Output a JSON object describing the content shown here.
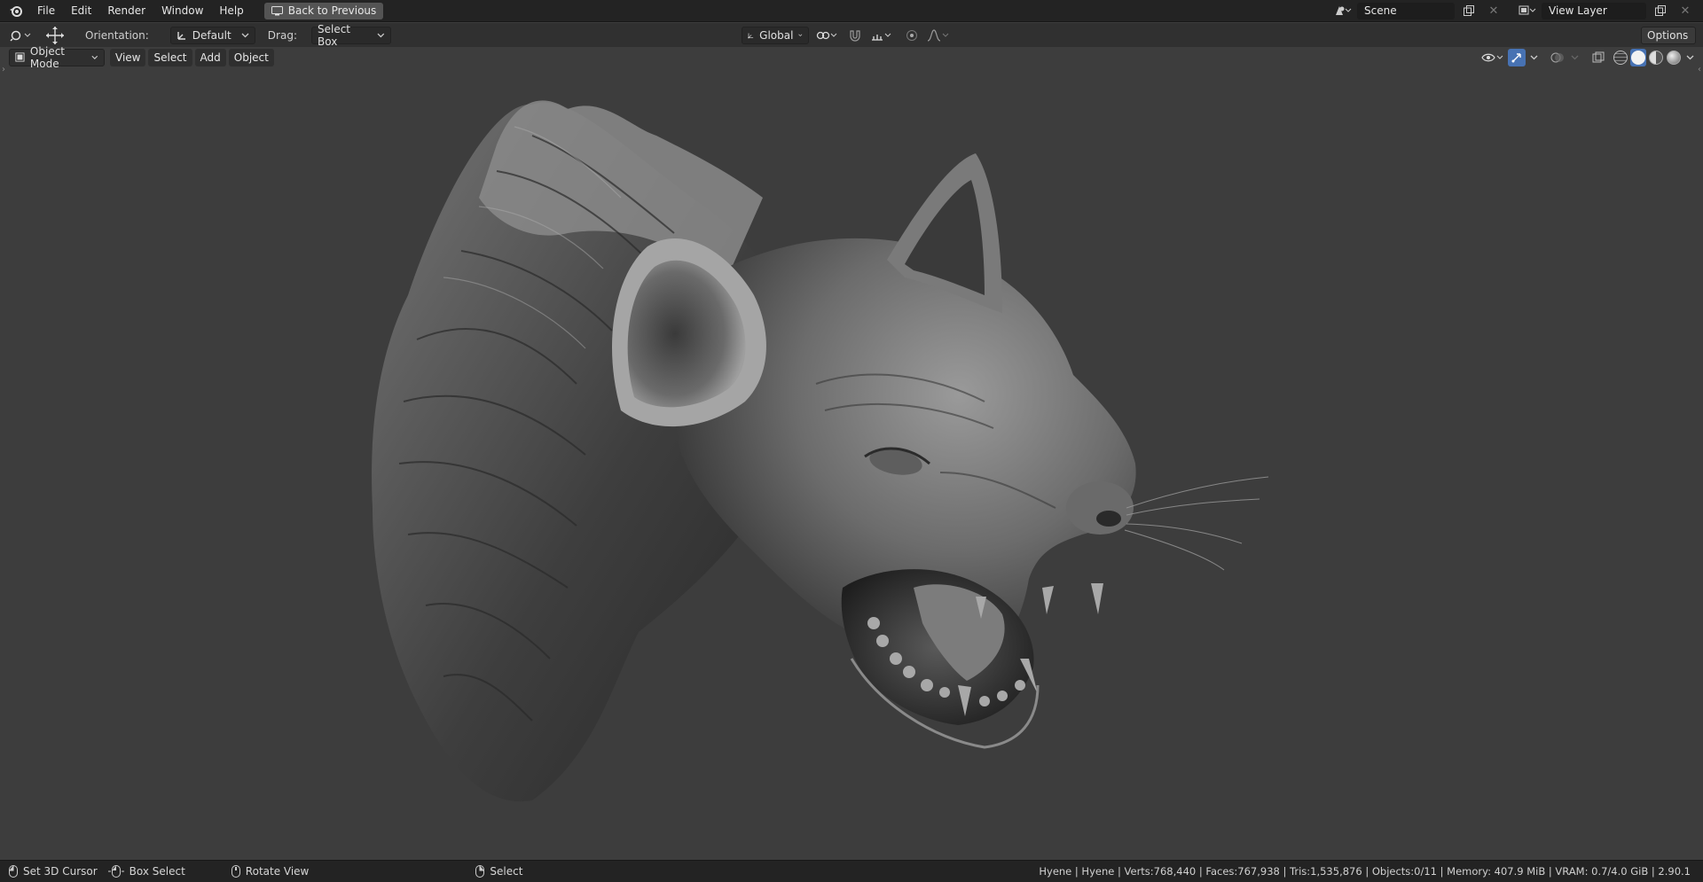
{
  "topbar": {
    "menus": [
      "File",
      "Edit",
      "Render",
      "Window",
      "Help"
    ],
    "back_button": "Back to Previous",
    "scene_name": "Scene",
    "view_layer_name": "View Layer"
  },
  "tool_header": {
    "orientation_label": "Orientation:",
    "orientation_value": "Default",
    "drag_label": "Drag:",
    "drag_value": "Select Box",
    "transform_orientation": "Global",
    "options_label": "Options"
  },
  "viewport_header": {
    "mode": "Object Mode",
    "menus": [
      "View",
      "Select",
      "Add",
      "Object"
    ]
  },
  "viewport": {
    "object_name": "Hyene",
    "background_color": "#3d3d3d"
  },
  "statusbar": {
    "left": [
      {
        "icon": "mouse-left-icon",
        "label": "Set 3D Cursor"
      },
      {
        "icon": "mouse-drag-icon",
        "label": "Box Select"
      },
      {
        "icon": "mouse-middle-icon",
        "label": "Rotate View"
      },
      {
        "icon": "mouse-right-icon",
        "label": "Select"
      }
    ],
    "stats": "Hyene | Hyene | Verts:768,440 | Faces:767,938 | Tris:1,535,876 | Objects:0/11 | Memory: 407.9 MiB | VRAM: 0.7/4.0 GiB | 2.90.1"
  },
  "colors": {
    "accent": "#4772b3",
    "header_bg": "#232323",
    "toolbar_bg": "#303030"
  }
}
